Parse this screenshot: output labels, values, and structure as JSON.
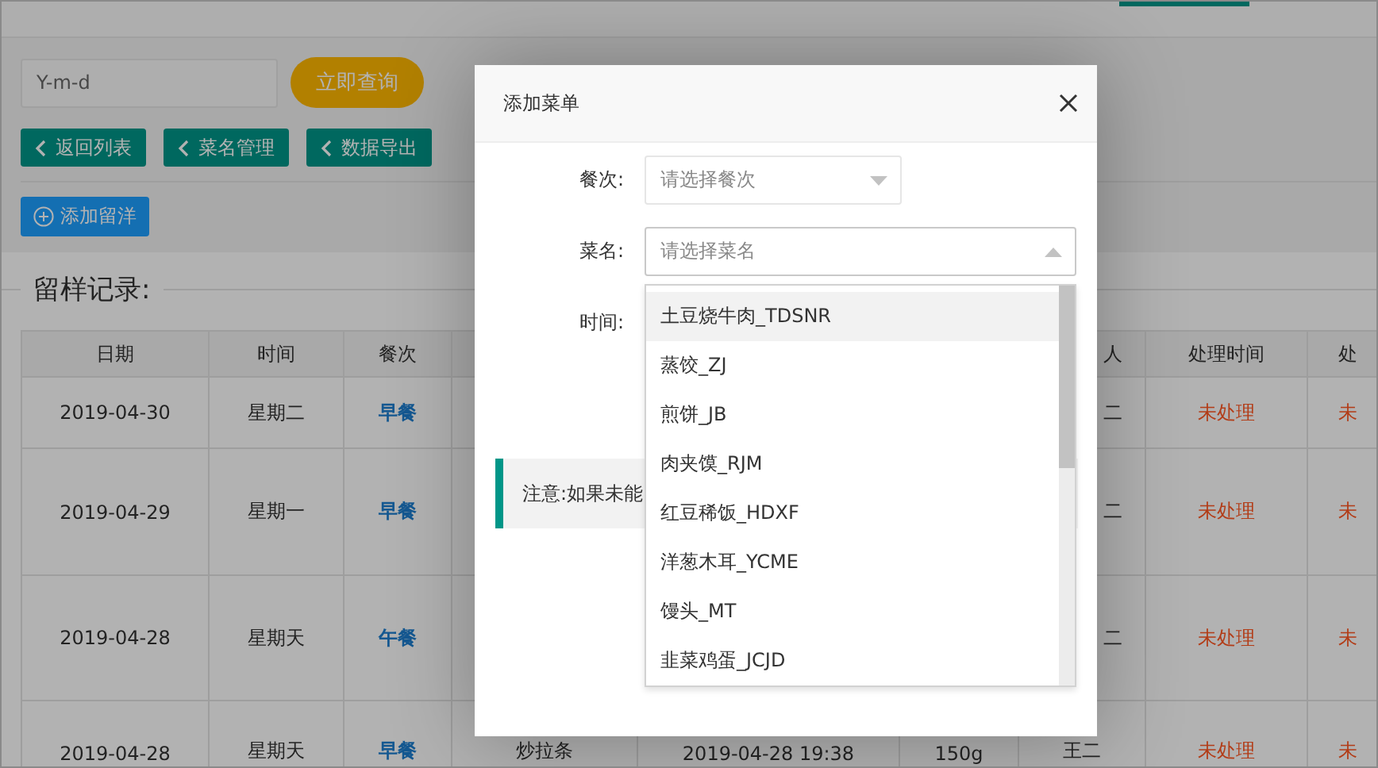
{
  "search": {
    "placeholder": "Y-m-d",
    "button": "立即查询"
  },
  "nav_buttons": [
    "返回列表",
    "菜名管理",
    "数据导出"
  ],
  "add_button": "添加留洋",
  "section_title": "留样记录:",
  "table": {
    "columns": [
      "日期",
      "时间",
      "餐次",
      null,
      null,
      null,
      "人",
      "处理时间",
      "处"
    ],
    "rows": [
      {
        "cells": [
          "2019-04-30",
          "星期二",
          "早餐",
          null,
          null,
          null,
          "二",
          "未处理",
          "未"
        ]
      },
      {
        "cells": [
          "2019-04-29",
          "星期一",
          "早餐",
          null,
          null,
          null,
          "二",
          "未处理",
          "未"
        ]
      },
      {
        "cells": [
          "2019-04-28",
          "星期天",
          "午餐",
          null,
          null,
          null,
          "二",
          "未处理",
          "未"
        ]
      },
      {
        "cells": [
          "2019-04-28",
          "星期天",
          "早餐",
          "炒拉条",
          "2019-04-28 19:38",
          "150g",
          "王二",
          "未处理",
          "未"
        ]
      }
    ]
  },
  "dialog": {
    "title": "添加菜单",
    "fields": [
      {
        "label": "餐次:",
        "placeholder": "请选择餐次",
        "expanded": false
      },
      {
        "label": "菜名:",
        "placeholder": "请选择菜名",
        "expanded": true,
        "options": [
          {
            "label": "土豆烧牛肉_TDSNR",
            "selected": true
          },
          {
            "label": "蒸饺_ZJ",
            "selected": false
          },
          {
            "label": "煎饼_JB",
            "selected": false
          },
          {
            "label": "肉夹馍_RJM",
            "selected": false
          },
          {
            "label": "红豆稀饭_HDXF",
            "selected": false
          },
          {
            "label": "洋葱木耳_YCME",
            "selected": false
          },
          {
            "label": "馒头_MT",
            "selected": false
          },
          {
            "label": "韭菜鸡蛋_JCJD",
            "selected": false
          }
        ]
      },
      {
        "label": "时间:"
      }
    ],
    "note": "注意:如果未能"
  }
}
